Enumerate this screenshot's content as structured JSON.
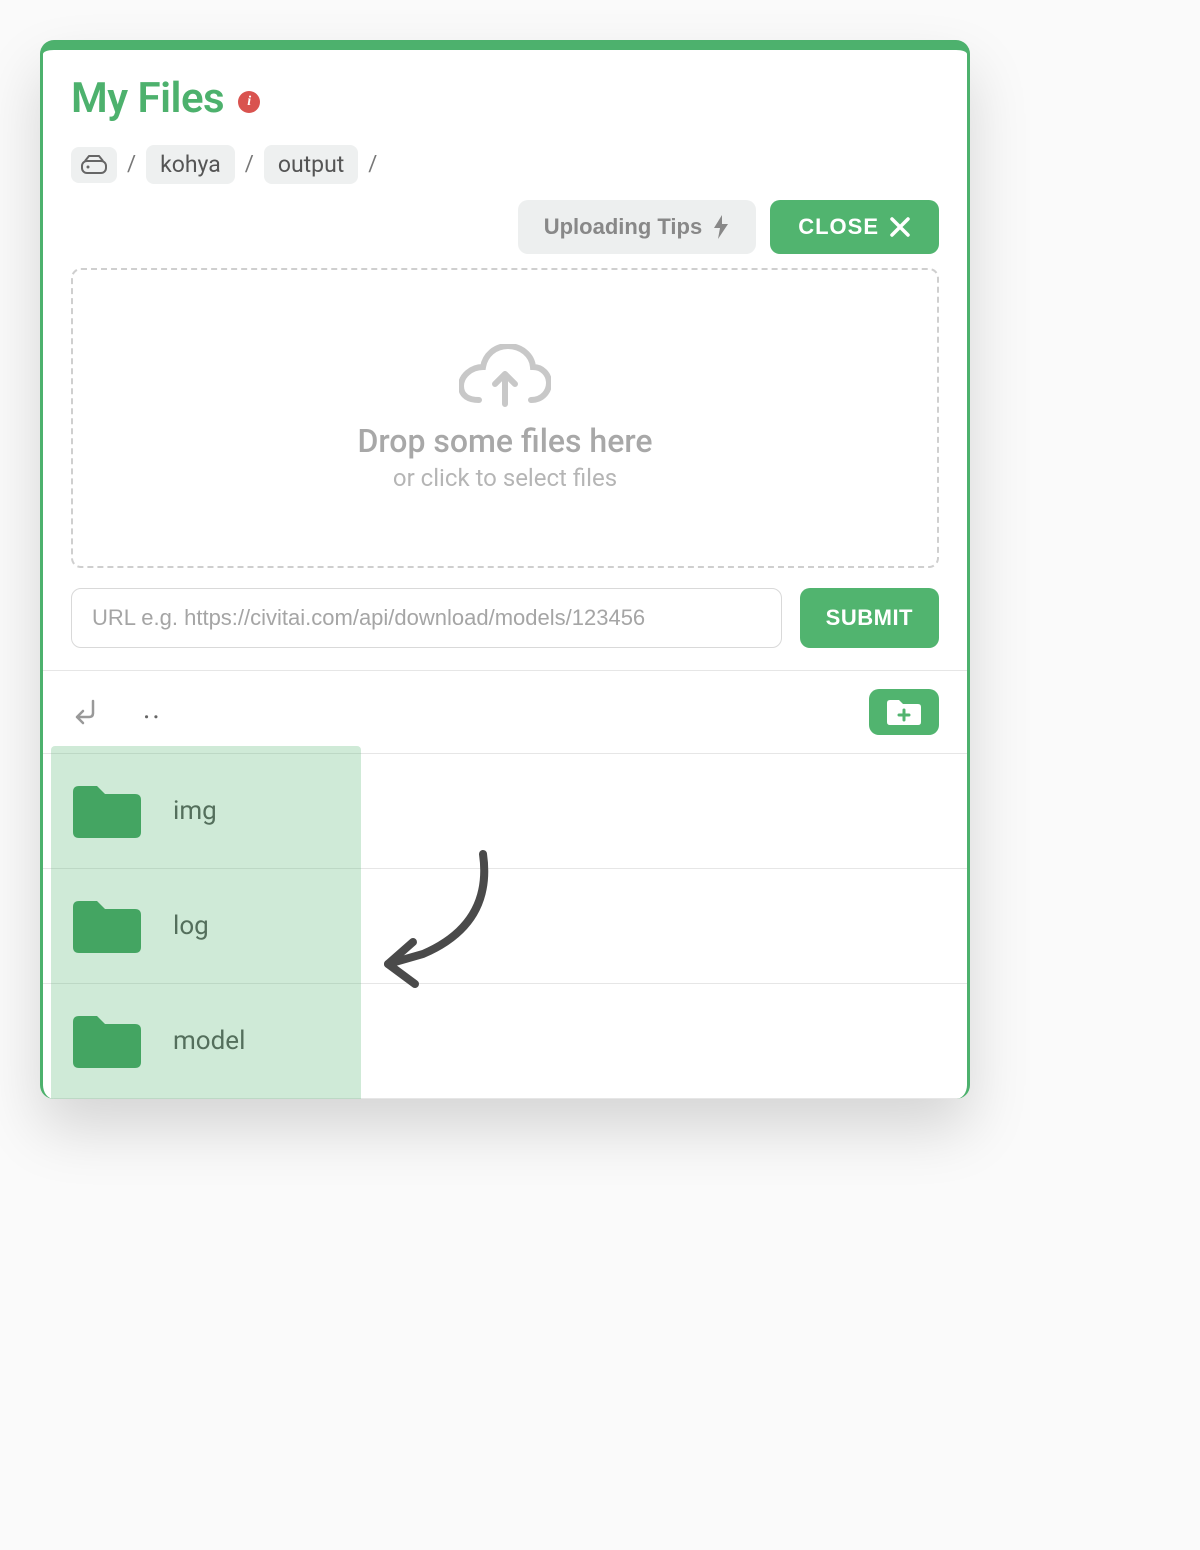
{
  "header": {
    "title": "My Files",
    "info_glyph": "i"
  },
  "breadcrumb": {
    "items": [
      "kohya",
      "output"
    ]
  },
  "actions": {
    "tips_label": "Uploading Tips",
    "close_label": "CLOSE",
    "submit_label": "SUBMIT"
  },
  "dropzone": {
    "main_text": "Drop some files here",
    "sub_text": "or click to select files"
  },
  "url_input": {
    "placeholder": "URL e.g. https://civitai.com/api/download/models/123456",
    "value": ""
  },
  "nav": {
    "parent_dir": ".."
  },
  "files": [
    {
      "name": "img",
      "type": "folder"
    },
    {
      "name": "log",
      "type": "folder"
    },
    {
      "name": "model",
      "type": "folder"
    }
  ],
  "icons": {
    "info": "info-icon",
    "drive": "drive-icon",
    "cloud_upload": "cloud-upload-icon",
    "lightning": "lightning-icon",
    "close": "close-icon",
    "back": "back-arrow-icon",
    "new_folder": "new-folder-icon",
    "folder": "folder-icon"
  },
  "colors": {
    "accent": "#4db16d",
    "accent_btn": "#51b46f",
    "danger": "#d9534f",
    "muted": "#a8a8a8"
  }
}
